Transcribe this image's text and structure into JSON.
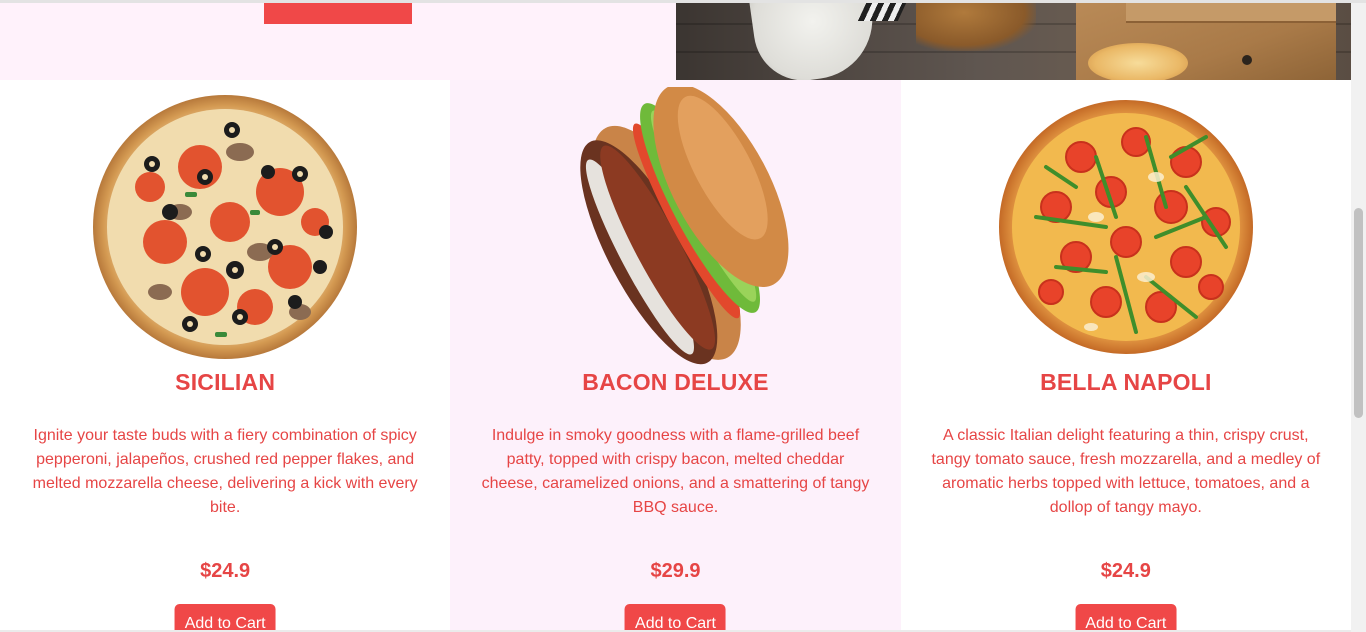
{
  "hero": {
    "photo_icon": "pizza-party-photo"
  },
  "products": [
    {
      "image_icon": "sicilian-pizza-image",
      "name": "SICILIAN",
      "description": "Ignite your taste buds with a fiery combination of spicy pepperoni, jalapeños, crushed red pepper flakes, and melted mozzarella cheese, delivering a kick with every bite.",
      "price": "$24.9",
      "button_label": "Add to Cart"
    },
    {
      "image_icon": "bacon-burger-image",
      "name": "BACON DELUXE",
      "description": "Indulge in smoky goodness with a flame-grilled beef patty, topped with crispy bacon, melted cheddar cheese, caramelized onions, and a smattering of tangy BBQ sauce.",
      "price": "$29.9",
      "button_label": "Add to Cart"
    },
    {
      "image_icon": "bella-napoli-pizza-image",
      "name": "BELLA NAPOLI",
      "description": "A classic Italian delight featuring a thin, crispy crust, tangy tomato sauce, fresh mozzarella, and a medley of aromatic herbs topped with lettuce, tomatoes, and a dollop of tangy mayo.",
      "price": "$24.9",
      "button_label": "Add to Cart"
    }
  ],
  "colors": {
    "accent": "#e64545",
    "button": "#f04848",
    "pink_bg": "#fdf1fb"
  }
}
